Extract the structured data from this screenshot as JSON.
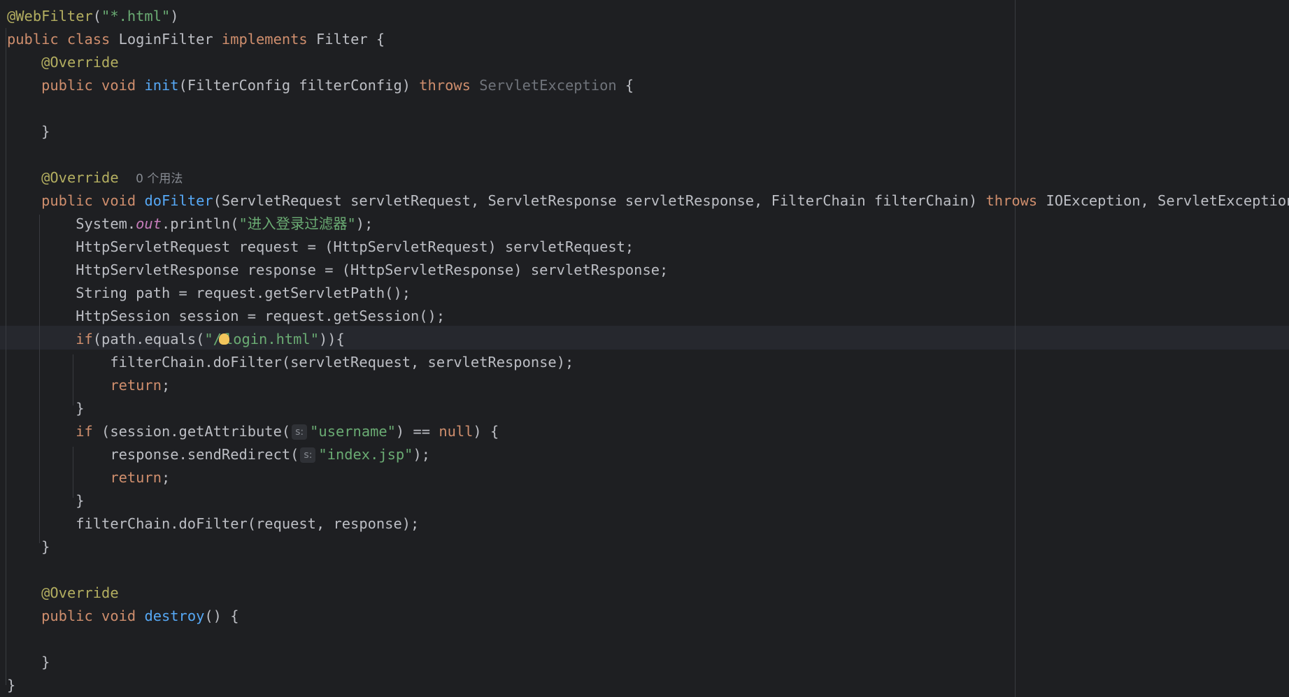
{
  "editor": {
    "language": "Java",
    "usage_hint": "0 个用法",
    "inlay_param_hint": "s:",
    "colors": {
      "background": "#1e1f22",
      "keyword": "#cf8e6d",
      "annotation": "#b3ae60",
      "function": "#56a8f5",
      "string": "#6aab73",
      "static_field": "#c77dbb",
      "text": "#bcbec4"
    }
  },
  "code": {
    "l1": {
      "annotation": "@WebFilter",
      "open": "(",
      "str": "\"*.html\"",
      "close": ")"
    },
    "l2": {
      "kw": "public class",
      "name": " LoginFilter ",
      "kw2": "implements",
      "rest": " Filter {"
    },
    "l3": {
      "annotation": "@Override"
    },
    "l4": {
      "kw": "public void",
      "fn": "init",
      "params": "(FilterConfig filterConfig) ",
      "kw2": "throws",
      "exc": "ServletException",
      "rest": " {"
    },
    "l6": {
      "text": "}"
    },
    "l8": {
      "annotation": "@Override"
    },
    "l9": {
      "kw": "public void",
      "fn": "doFilter",
      "params": "(ServletRequest servletRequest, ServletResponse servletResponse, FilterChain filterChain) ",
      "kw2": "throws",
      "rest": " IOException, ServletException {"
    },
    "l10": {
      "a": "System.",
      "static": "out",
      "b": ".println(",
      "str": "\"进入登录过滤器\"",
      "c": ");"
    },
    "l11": {
      "text": "HttpServletRequest request = (HttpServletRequest) servletRequest;"
    },
    "l12": {
      "text": "HttpServletResponse response = (HttpServletResponse) servletResponse;"
    },
    "l13": {
      "text": "String path = request.getServletPath();"
    },
    "l14": {
      "text": "HttpSession session = request.getSession();"
    },
    "l15": {
      "kw": "if",
      "a": "(path.equals(",
      "str1": "\"/",
      "str2": "login.html\"",
      "b": ")){"
    },
    "l16": {
      "text": "filterChain.doFilter(servletRequest, servletResponse);"
    },
    "l17": {
      "kw": "return",
      "rest": ";"
    },
    "l18": {
      "text": "}"
    },
    "l19": {
      "kw": "if",
      "a": " (session.getAttribute(",
      "str": "\"username\"",
      "b": ") == ",
      "kw2": "null",
      "c": ") {"
    },
    "l20": {
      "a": "response.sendRedirect(",
      "str": "\"index.jsp\"",
      "b": ");"
    },
    "l21": {
      "kw": "return",
      "rest": ";"
    },
    "l22": {
      "text": "}"
    },
    "l23": {
      "text": "filterChain.doFilter(request, response);"
    },
    "l24": {
      "text": "}"
    },
    "l26": {
      "annotation": "@Override"
    },
    "l27": {
      "kw": "public void",
      "fn": "destroy",
      "rest": "() {"
    },
    "l29": {
      "text": "}"
    },
    "l30": {
      "text": "}"
    }
  }
}
